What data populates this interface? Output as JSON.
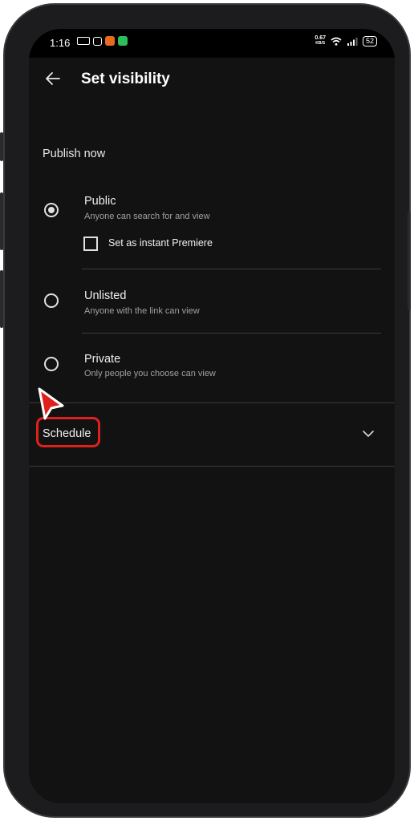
{
  "status_bar": {
    "time": "1:16",
    "speed_top": "0.67",
    "speed_bottom": "KB/S",
    "battery": "52"
  },
  "header": {
    "title": "Set visibility"
  },
  "publish": {
    "section_label": "Publish now",
    "options": [
      {
        "title": "Public",
        "subtitle": "Anyone can search for and view",
        "selected": true
      },
      {
        "title": "Unlisted",
        "subtitle": "Anyone with the link can view",
        "selected": false
      },
      {
        "title": "Private",
        "subtitle": "Only people you choose can view",
        "selected": false
      }
    ],
    "premiere_label": "Set as instant Premiere",
    "premiere_checked": false
  },
  "schedule": {
    "label": "Schedule"
  },
  "colors": {
    "highlight": "#e0201a",
    "background": "#121212"
  }
}
